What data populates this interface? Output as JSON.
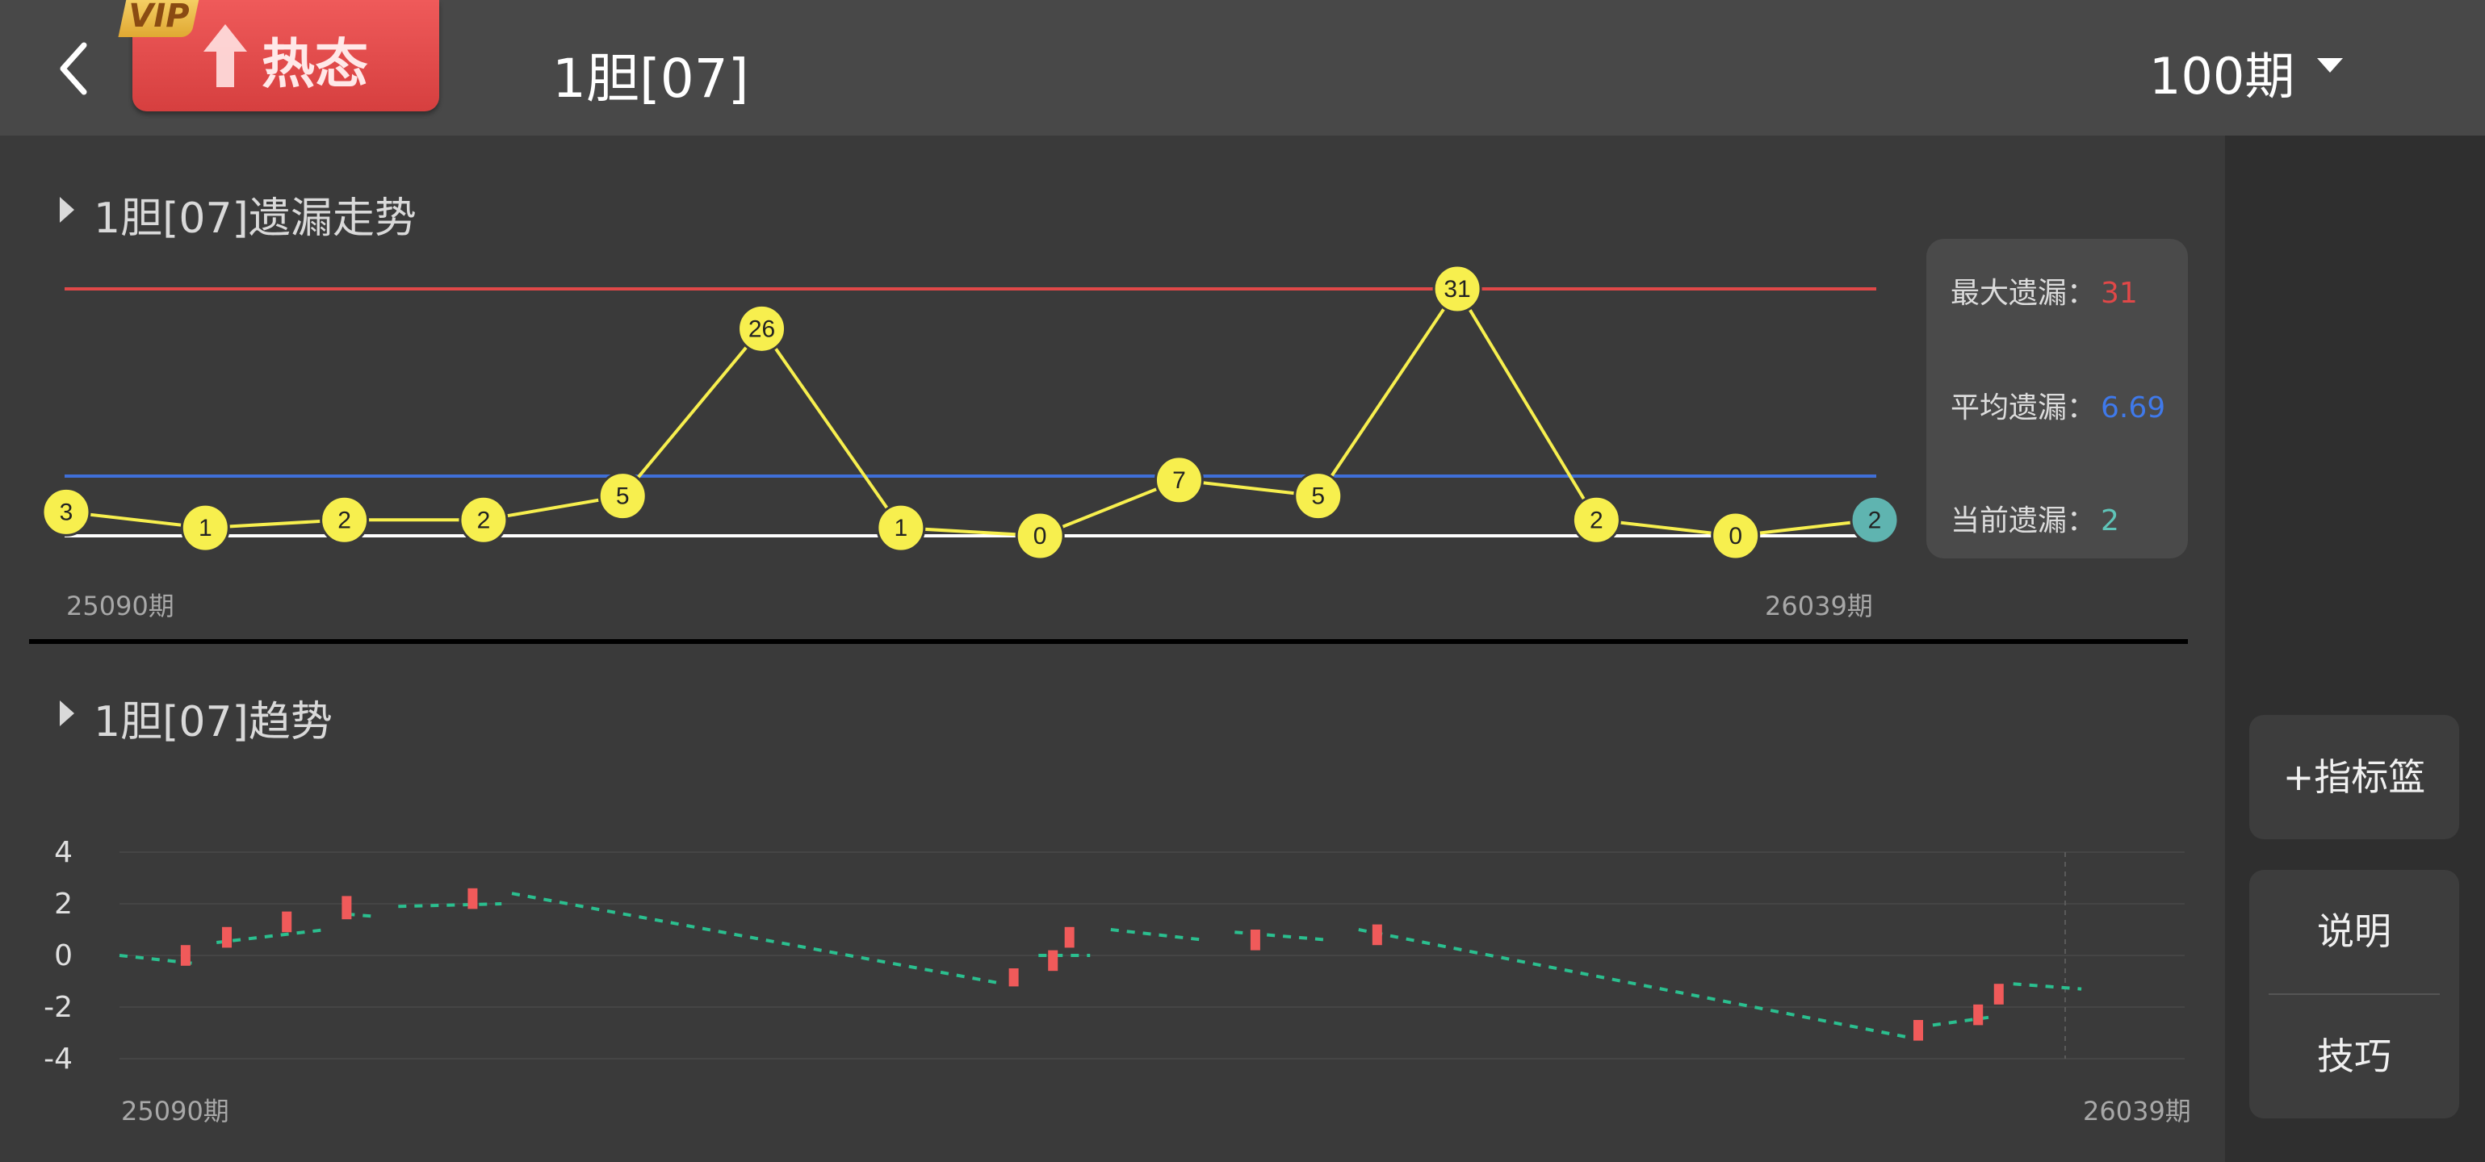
{
  "header": {
    "vip_badge": "VIP",
    "hot_label": "热态",
    "title": "1胆[07]",
    "period_select": "100期"
  },
  "sidebar": {
    "add_indicator": "+指标篮",
    "explain": "说明",
    "tips": "技巧"
  },
  "miss_panel": {
    "title": "1胆[07]遗漏走势",
    "stats": {
      "max_label": "最大遗漏：",
      "max_value": "31",
      "avg_label": "平均遗漏：",
      "avg_value": "6.69",
      "current_label": "当前遗漏：",
      "current_value": "2"
    },
    "x_start": "25090期",
    "x_end": "26039期"
  },
  "trend_panel": {
    "title": "1胆[07]趋势",
    "y_ticks": [
      "4",
      "2",
      "0",
      "-2",
      "-4"
    ],
    "x_start": "25090期",
    "x_end": "26039期"
  },
  "colors": {
    "max_line": "#e04848",
    "avg_line": "#3f6fd8",
    "base_line": "#ffffff",
    "point_fill": "#f7ef4e",
    "current_point": "#5fb4b0",
    "trend_dash": "#2bbf8f",
    "candle": "#f05a5a"
  },
  "chart_data": [
    {
      "type": "line",
      "title": "1胆[07]遗漏走势",
      "values": [
        3,
        1,
        2,
        2,
        5,
        26,
        1,
        0,
        7,
        5,
        31,
        2,
        0,
        2
      ],
      "reference_lines": {
        "max": 31,
        "avg": 6.69
      },
      "x_start": "25090期",
      "x_end": "26039期"
    },
    {
      "type": "line",
      "title": "1胆[07]趋势",
      "ylim": [
        -4,
        4
      ],
      "yticks": [
        4,
        2,
        0,
        -2,
        -4
      ],
      "x_start": "25090期",
      "x_end": "26039期",
      "segments": [
        [
          0,
          0.0,
          0.035,
          -0.3
        ],
        [
          0.047,
          0.5,
          0.1,
          1.0
        ],
        [
          0.11,
          1.6,
          0.125,
          1.5
        ],
        [
          0.135,
          1.9,
          0.185,
          2.0
        ],
        [
          0.19,
          2.4,
          0.428,
          -1.1
        ],
        [
          0.445,
          0.0,
          0.47,
          0.0
        ],
        [
          0.48,
          1.0,
          0.525,
          0.6
        ],
        [
          0.54,
          0.9,
          0.585,
          0.6
        ],
        [
          0.6,
          1.0,
          0.868,
          -3.2
        ],
        [
          0.878,
          -2.7,
          0.905,
          -2.4
        ],
        [
          0.917,
          -1.1,
          0.95,
          -1.3
        ]
      ],
      "candles": [
        [
          0.032,
          -0.4,
          0.4
        ],
        [
          0.052,
          0.3,
          1.1
        ],
        [
          0.081,
          0.9,
          1.7
        ],
        [
          0.11,
          1.4,
          2.3
        ],
        [
          0.171,
          1.8,
          2.6
        ],
        [
          0.433,
          -1.2,
          -0.5
        ],
        [
          0.452,
          -0.6,
          0.2
        ],
        [
          0.46,
          0.3,
          1.1
        ],
        [
          0.55,
          0.2,
          1.0
        ],
        [
          0.609,
          0.4,
          1.2
        ],
        [
          0.871,
          -3.3,
          -2.5
        ],
        [
          0.9,
          -2.7,
          -1.9
        ],
        [
          0.91,
          -1.9,
          -1.1
        ]
      ]
    }
  ]
}
